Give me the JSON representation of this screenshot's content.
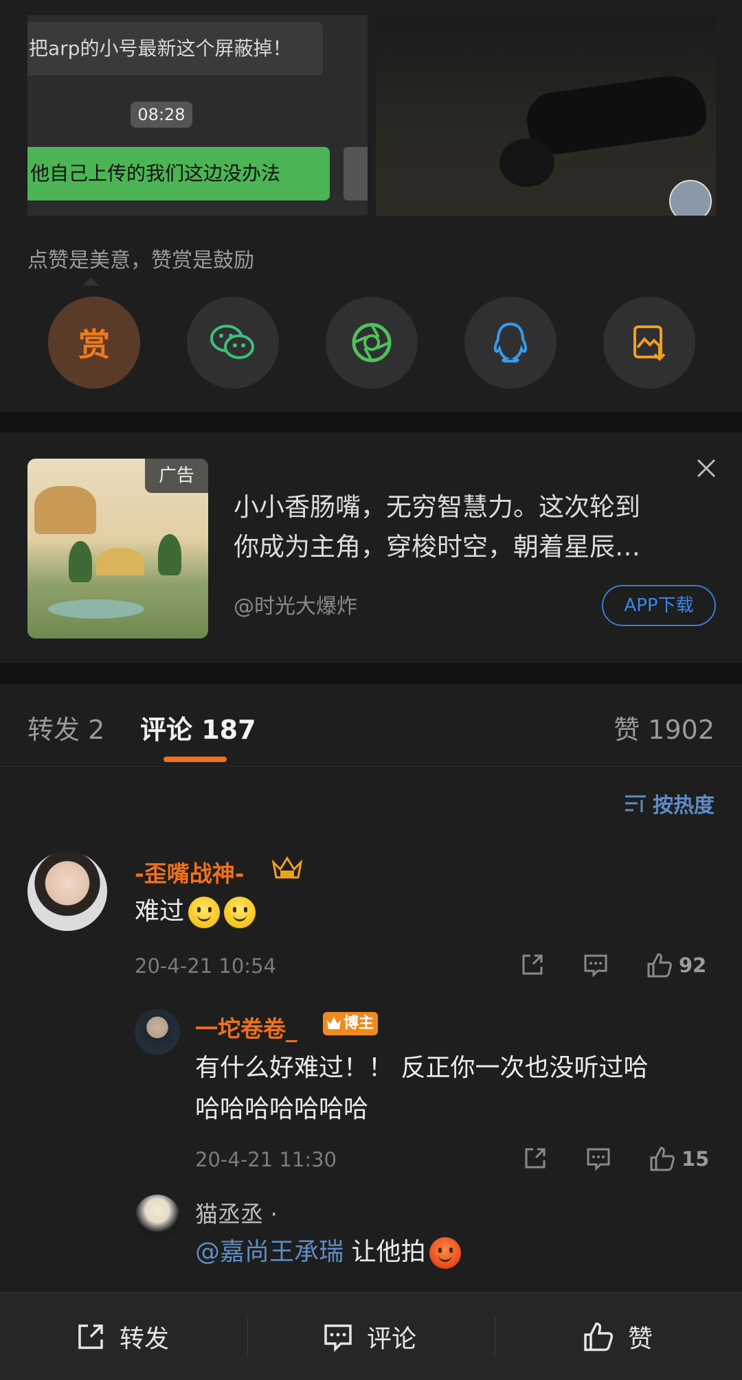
{
  "top_images": {
    "left_chat": {
      "top_message": "把arp的小号最新这个屏蔽掉！",
      "time": "08:28",
      "green_message": "他自己上传的我们这边没办法"
    }
  },
  "reward": {
    "caption": "点赞是美意，赞赏是鼓励",
    "reward_label": "赏",
    "share_buttons": [
      "wechat-icon",
      "moments-icon",
      "qq-icon",
      "save-image-icon"
    ],
    "colors": {
      "reward": "#f07a1c",
      "wechat": "#3ec07a",
      "moments": "#4cc45a",
      "qq": "#3a9ae8",
      "save": "#f0a020"
    }
  },
  "ad": {
    "badge": "广告",
    "text_line1": "小小香肠嘴，无穷智慧力。这次轮到",
    "text_line2": "你成为主角，穿梭时空，朝着星辰…",
    "source": "@时光大爆炸",
    "button": "APP下载"
  },
  "tabs": {
    "repost": "转发 2",
    "comments": "评论 187",
    "likes": "赞 1902"
  },
  "sort": {
    "label": "按热度"
  },
  "comments": [
    {
      "user": "-歪嘴战神-",
      "text": "难过",
      "time": "20-4-21 10:54",
      "likes": "92",
      "replies": [
        {
          "user": "一坨卷卷_",
          "badge": "博主",
          "text_line1": "有什么好难过！！ 反正你一次也没听过哈",
          "text_line2": "哈哈哈哈哈哈哈",
          "time": "20-4-21 11:30",
          "likes": "15"
        },
        {
          "user": "猫丞丞 ·",
          "mention": "@嘉尚王承瑞",
          "text": "让他拍"
        }
      ]
    }
  ],
  "bottom_bar": {
    "repost": "转发",
    "comment": "评论",
    "like": "赞"
  },
  "accent": "#f0701e",
  "link_color": "#5e8cc6"
}
